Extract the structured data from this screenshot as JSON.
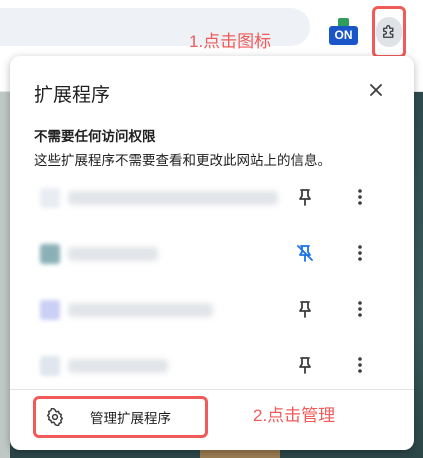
{
  "annotations": {
    "step1": "1.点击图标",
    "step2": "2.点击管理"
  },
  "toolbar": {
    "badge_text": "ON"
  },
  "popup": {
    "title": "扩展程序",
    "section_title": "不需要任何访问权限",
    "section_desc": "这些扩展程序不需要查看和更改此网站上的信息。",
    "extensions": [
      {
        "pinned": false
      },
      {
        "pinned": true
      },
      {
        "pinned": false
      },
      {
        "pinned": false
      }
    ],
    "manage_label": "管理扩展程序"
  },
  "colors": {
    "annotation_red": "#f05a58",
    "pinned_blue": "#1a73e8",
    "icon_dark": "#3c3c3c",
    "badge_blue": "#1a56c8",
    "badge_green": "#2f9e5a"
  }
}
